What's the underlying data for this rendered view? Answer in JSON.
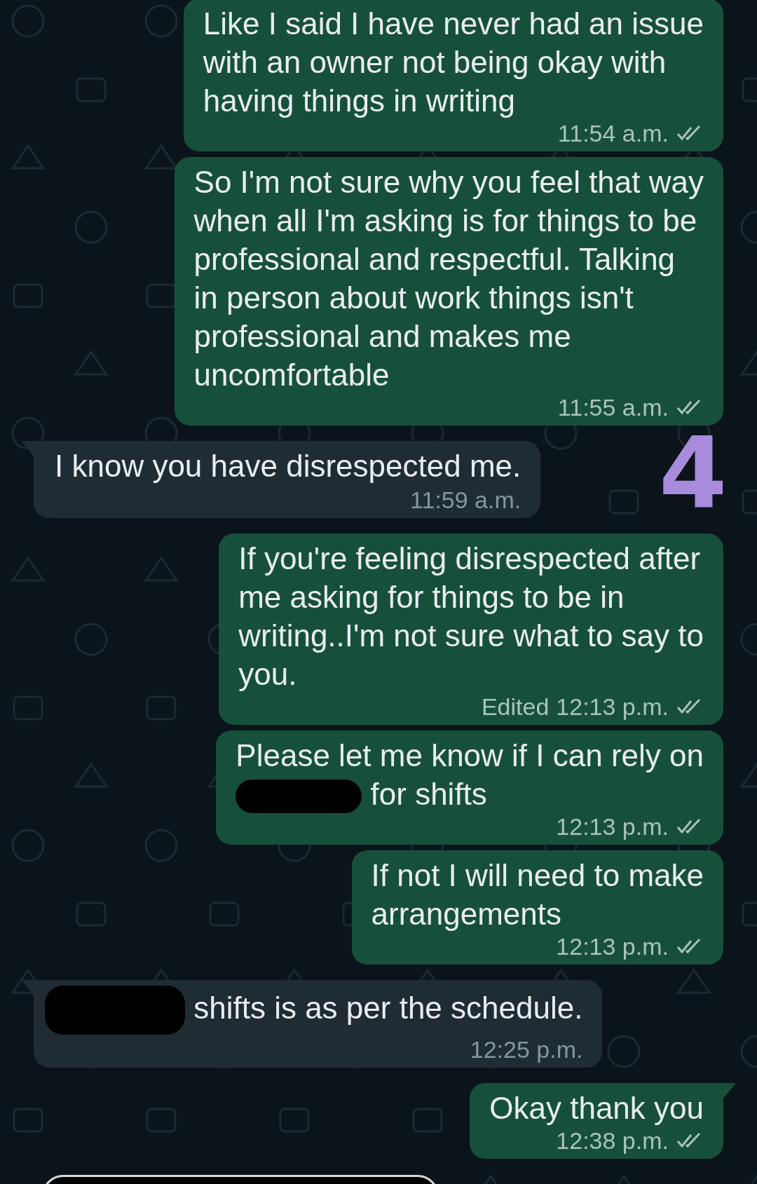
{
  "messages": [
    {
      "kind": "out",
      "tail": false,
      "parts": [
        {
          "kind": "text",
          "text": "Like I said I have never had an issue\nwith an owner not being okay with\nhaving things in writing"
        }
      ],
      "edited": false,
      "time": "11:54 a.m.",
      "ticks": true
    },
    {
      "kind": "out",
      "tail": false,
      "parts": [
        {
          "kind": "text",
          "text": "So I'm not sure why you feel that way\nwhen all I'm asking is for things to be\nprofessional and respectful. Talking\nin person about work things isn't\nprofessional and makes me\nuncomfortable"
        }
      ],
      "edited": false,
      "time": "11:55 a.m.",
      "ticks": true
    },
    {
      "kind": "in",
      "tail": true,
      "parts": [
        {
          "kind": "text",
          "text": "I know you have disrespected me."
        }
      ],
      "edited": false,
      "time": "11:59 a.m.",
      "ticks": false
    },
    {
      "kind": "out",
      "tail": false,
      "parts": [
        {
          "kind": "text",
          "text": "If you're feeling disrespected after\nme asking for things to be in\nwriting..I'm not sure what to say to\nyou."
        }
      ],
      "edited": true,
      "edited_label": "Edited",
      "time": "12:13 p.m.",
      "ticks": true
    },
    {
      "kind": "out",
      "tail": false,
      "parts": [
        {
          "kind": "text",
          "text": "Please let me know if I can rely on\n"
        },
        {
          "kind": "redaction"
        },
        {
          "kind": "text",
          "text": " for shifts"
        }
      ],
      "edited": false,
      "time": "12:13 p.m.",
      "ticks": true
    },
    {
      "kind": "out",
      "tail": false,
      "parts": [
        {
          "kind": "text",
          "text": "If not I will need to make\narrangements"
        }
      ],
      "edited": false,
      "time": "12:13 p.m.",
      "ticks": true
    },
    {
      "kind": "in",
      "tail": true,
      "parts": [
        {
          "kind": "redaction"
        },
        {
          "kind": "text",
          "text": " shifts is as per the schedule."
        }
      ],
      "edited": false,
      "time": "12:25 p.m.",
      "ticks": false
    },
    {
      "kind": "out",
      "tail": true,
      "parts": [
        {
          "kind": "text",
          "text": "Okay thank you"
        }
      ],
      "edited": false,
      "time": "12:38 p.m.",
      "ticks": true
    }
  ],
  "annotation": "4"
}
